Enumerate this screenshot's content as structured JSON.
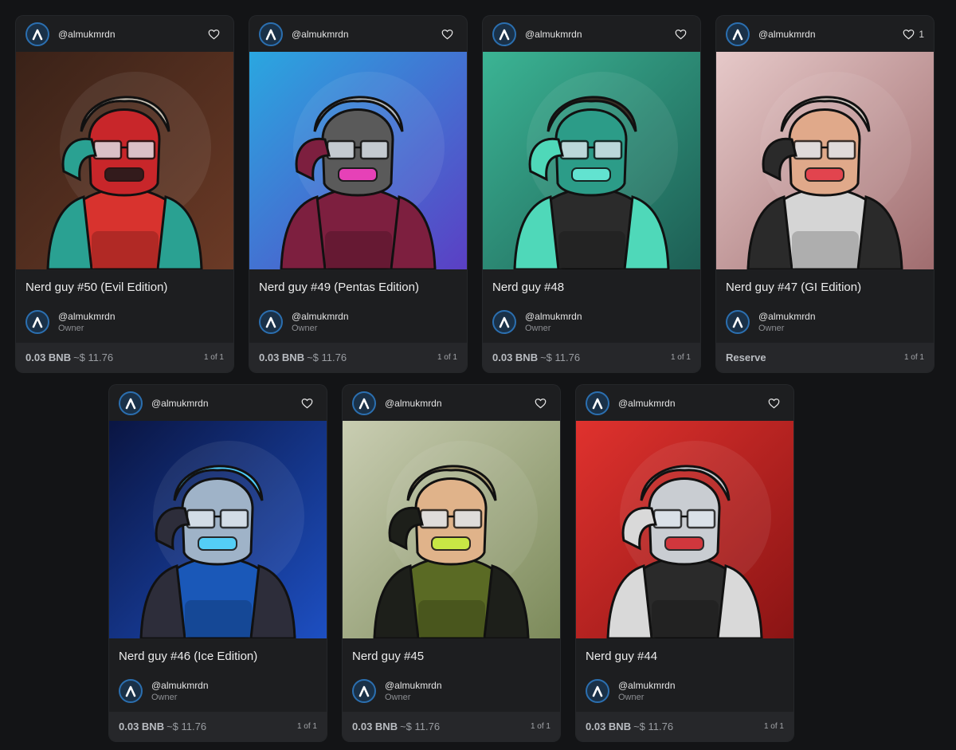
{
  "cards": [
    {
      "handle": "@almukmrdn",
      "likes": "",
      "title": "Nerd guy #50 (Evil Edition)",
      "owner_handle": "@almukmrdn",
      "owner_role": "Owner",
      "price": "0.03 BNB",
      "price_usd": "~$ 11.76",
      "edition": "1 of 1",
      "art": {
        "bg1": "#3a2218",
        "bg2": "#6b3a26",
        "hoodie": "#d8332e",
        "sleeve": "#2aa192",
        "head": "#c8262a",
        "hair": "#c9c2b5",
        "accent": "#1a1a1a"
      }
    },
    {
      "handle": "@almukmrdn",
      "likes": "",
      "title": "Nerd guy #49 (Pentas Edition)",
      "owner_handle": "@almukmrdn",
      "owner_role": "Owner",
      "price": "0.03 BNB",
      "price_usd": "~$ 11.76",
      "edition": "1 of 1",
      "art": {
        "bg1": "#2aa7e0",
        "bg2": "#5b3fc4",
        "hoodie": "#7d1f3f",
        "sleeve": "#7d1f3f",
        "head": "#5a5a5a",
        "hair": "#b5b9bd",
        "accent": "#ff3dc8"
      }
    },
    {
      "handle": "@almukmrdn",
      "likes": "",
      "title": "Nerd guy #48",
      "owner_handle": "@almukmrdn",
      "owner_role": "Owner",
      "price": "0.03 BNB",
      "price_usd": "~$ 11.76",
      "edition": "1 of 1",
      "art": {
        "bg1": "#3bb494",
        "bg2": "#1d5e54",
        "hoodie": "#2b2b2b",
        "sleeve": "#4fd8b9",
        "head": "#2c9c88",
        "hair": "#3a2f25",
        "accent": "#6cf0dd"
      }
    },
    {
      "handle": "@almukmrdn",
      "likes": "1",
      "title": "Nerd guy #47 (GI Edition)",
      "owner_handle": "@almukmrdn",
      "owner_role": "Owner",
      "price": "Reserve",
      "price_usd": "",
      "edition": "1 of 1",
      "art": {
        "bg1": "#e6c9c9",
        "bg2": "#a06d6f",
        "hoodie": "#d5d5d5",
        "sleeve": "#2a2a2a",
        "head": "#e0a98a",
        "hair": "#cfc8c0",
        "accent": "#e33344"
      }
    },
    {
      "handle": "@almukmrdn",
      "likes": "",
      "title": "Nerd guy #46 (Ice Edition)",
      "owner_handle": "@almukmrdn",
      "owner_role": "Owner",
      "price": "0.03 BNB",
      "price_usd": "~$ 11.76",
      "edition": "1 of 1",
      "art": {
        "bg1": "#0a1542",
        "bg2": "#1d4fc2",
        "hoodie": "#1a58b8",
        "sleeve": "#2d2d3a",
        "head": "#9fb3c8",
        "hair": "#4fd0ff",
        "accent": "#47d3ff"
      }
    },
    {
      "handle": "@almukmrdn",
      "likes": "",
      "title": "Nerd guy #45",
      "owner_handle": "@almukmrdn",
      "owner_role": "Owner",
      "price": "0.03 BNB",
      "price_usd": "~$ 11.76",
      "edition": "1 of 1",
      "art": {
        "bg1": "#c9cdb2",
        "bg2": "#7c8a5a",
        "hoodie": "#5a6a24",
        "sleeve": "#1d1f1a",
        "head": "#e0b38a",
        "hair": "#a89b72",
        "accent": "#c4f03a"
      }
    },
    {
      "handle": "@almukmrdn",
      "likes": "",
      "title": "Nerd guy #44",
      "owner_handle": "@almukmrdn",
      "owner_role": "Owner",
      "price": "0.03 BNB",
      "price_usd": "~$ 11.76",
      "edition": "1 of 1",
      "art": {
        "bg1": "#e0322e",
        "bg2": "#8a1414",
        "hoodie": "#2a2a2a",
        "sleeve": "#d9d9d9",
        "head": "#c9cdd2",
        "hair": "#c9cdd2",
        "accent": "#d21e24"
      }
    }
  ],
  "colors": {
    "page_bg": "#131416",
    "card_bg": "#1d1e20",
    "footer_bg": "#26272a",
    "avatar_ring": "#2b6fb0"
  },
  "icons": {
    "avatar": "creator-logo-icon",
    "like": "heart-icon"
  }
}
